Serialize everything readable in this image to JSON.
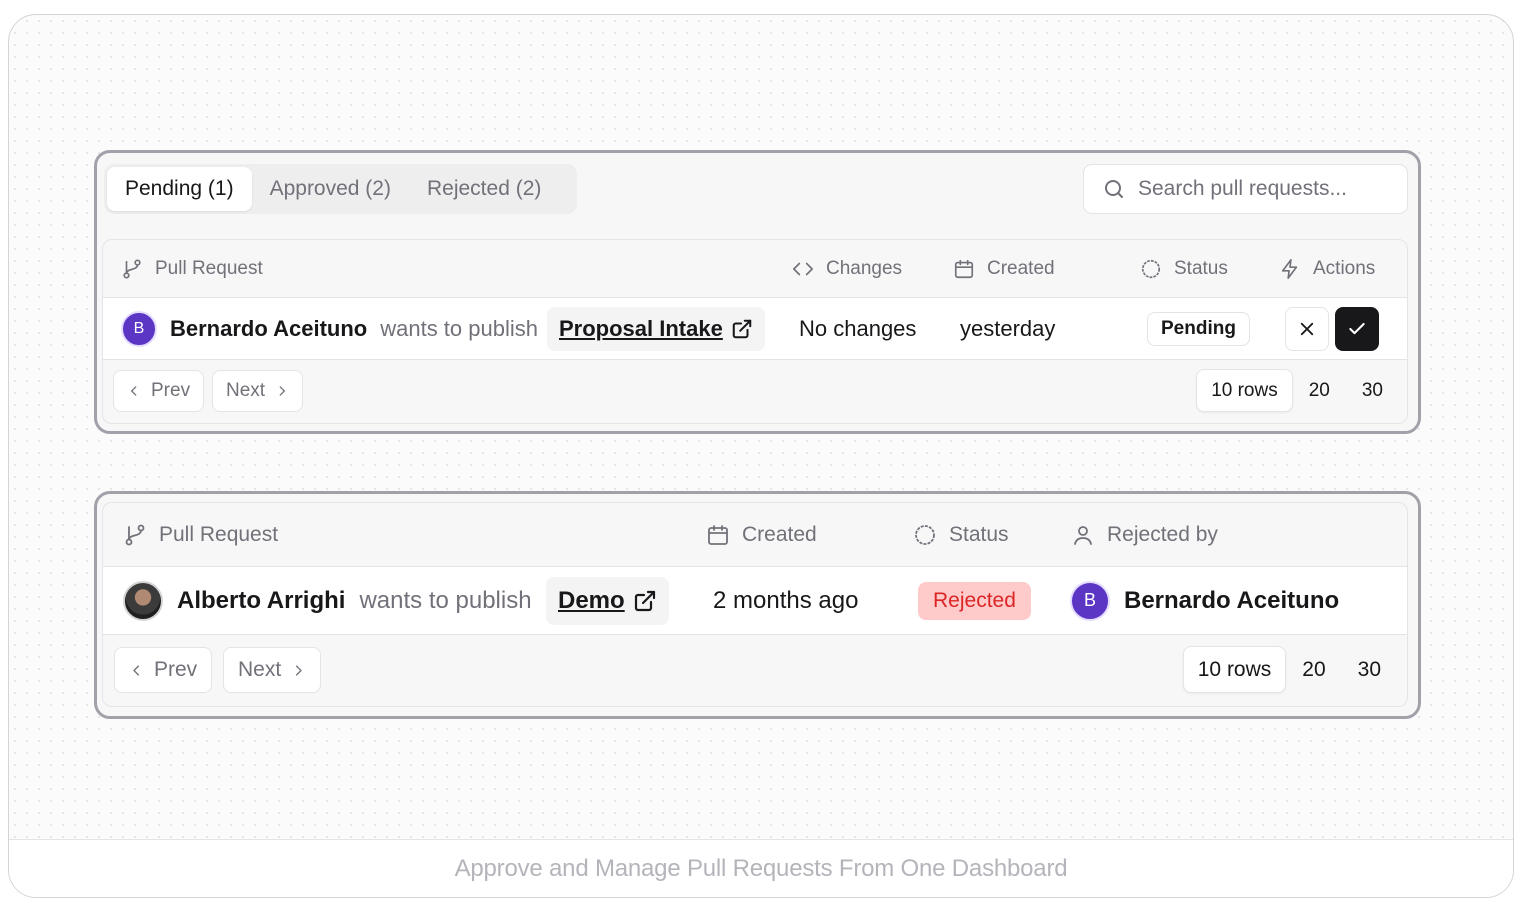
{
  "pending_panel": {
    "tabs": [
      {
        "label": "Pending (1)"
      },
      {
        "label": "Approved (2)"
      },
      {
        "label": "Rejected (2)"
      }
    ],
    "search": {
      "placeholder": "Search pull requests..."
    },
    "columns": {
      "pull_request": "Pull Request",
      "changes": "Changes",
      "created": "Created",
      "status": "Status",
      "actions": "Actions"
    },
    "row": {
      "avatar_letter": "B",
      "author": "Bernardo Aceituno",
      "verb": "wants to publish",
      "target": "Proposal Intake",
      "changes": "No changes",
      "created": "yesterday",
      "status": "Pending"
    },
    "pagination": {
      "prev": "Prev",
      "next": "Next",
      "rows_options": [
        "10 rows",
        "20",
        "30"
      ]
    }
  },
  "rejected_panel": {
    "columns": {
      "pull_request": "Pull Request",
      "created": "Created",
      "status": "Status",
      "rejected_by": "Rejected by"
    },
    "row": {
      "author": "Alberto Arrighi",
      "verb": "wants to publish",
      "target": "Demo",
      "created": "2 months ago",
      "status": "Rejected",
      "rejected_by_letter": "B",
      "rejected_by": "Bernardo Aceituno"
    },
    "pagination": {
      "prev": "Prev",
      "next": "Next",
      "rows_options": [
        "10 rows",
        "20",
        "30"
      ]
    }
  },
  "caption": "Approve and Manage Pull Requests From One Dashboard",
  "colors": {
    "avatar": "#5b35c4",
    "rejected_bg": "#fecaca",
    "rejected_text": "#dc2626",
    "approve_button": "#18181b"
  }
}
